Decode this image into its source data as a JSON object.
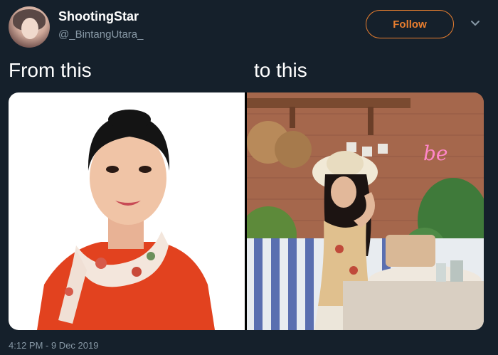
{
  "tweet": {
    "display_name": "ShootingStar",
    "handle": "@_BintangUtara_",
    "follow_label": "Follow",
    "caption_left": "From this",
    "caption_right": "to this",
    "timestamp": "4:12 PM - 9 Dec 2019"
  },
  "colors": {
    "background": "#15202b",
    "accent": "#e87e2f",
    "secondary_text": "#8899a6"
  },
  "icons": {
    "menu": "chevron-down-icon"
  }
}
